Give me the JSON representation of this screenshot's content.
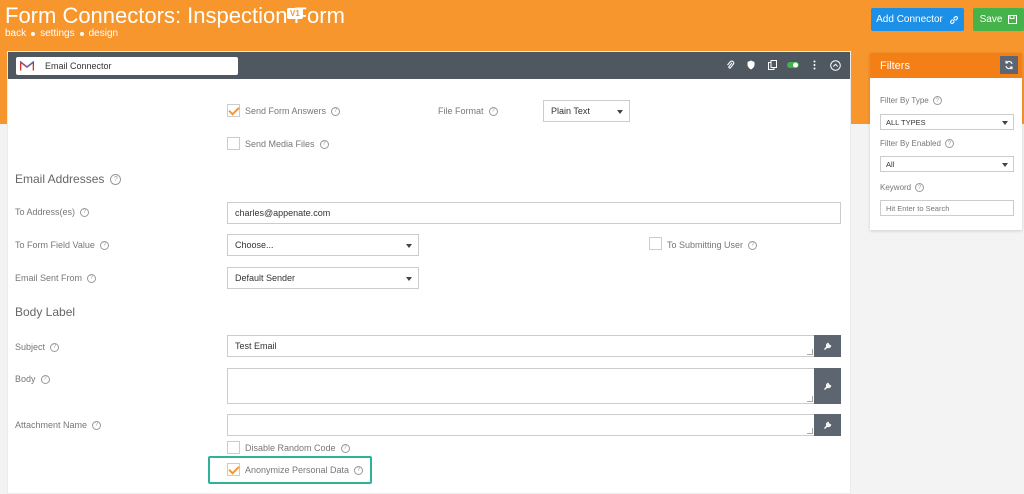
{
  "header": {
    "title": "Form Connectors: Inspection Form",
    "version": "V1",
    "breadcrumb": [
      "back",
      "settings",
      "design"
    ],
    "add_connector_label": "Add Connector",
    "save_label": "Save"
  },
  "connector": {
    "name": "Email Connector"
  },
  "options": {
    "send_form_answers": "Send Form Answers",
    "send_media_files": "Send Media Files",
    "file_format_label": "File Format",
    "file_format_value": "Plain Text"
  },
  "email_addresses": {
    "section_title": "Email Addresses",
    "to_address_label": "To Address(es)",
    "to_address_value": "charles@appenate.com",
    "to_form_field_label": "To Form Field Value",
    "to_form_field_value": "Choose...",
    "to_submitting_user": "To Submitting User",
    "sent_from_label": "Email Sent From",
    "sent_from_value": "Default Sender"
  },
  "body_label": {
    "section_title": "Body Label",
    "subject_label": "Subject",
    "subject_value": "Test Email",
    "body_label": "Body",
    "body_value": "",
    "attachment_label": "Attachment Name",
    "attachment_value": "",
    "disable_random_code": "Disable Random Code",
    "anonymize_personal_data": "Anonymize Personal Data"
  },
  "filters": {
    "title": "Filters",
    "type_label": "Filter By Type",
    "type_value": "ALL TYPES",
    "enabled_label": "Filter By Enabled",
    "enabled_value": "All",
    "keyword_label": "Keyword",
    "keyword_placeholder": "Hit Enter to Search"
  },
  "colors": {
    "header": "#f7962d",
    "filters_header": "#f57f17",
    "add_button": "#1c8fe6",
    "save_button": "#45b34a",
    "card_bar": "#4f5761",
    "highlight": "#2eb39a"
  },
  "icons": [
    "gmail-icon",
    "paperclip-icon",
    "shield-icon",
    "copy-icon",
    "toggle-icon",
    "more-vertical-icon",
    "collapse-icon",
    "link-icon",
    "save-icon",
    "wrench-icon",
    "refresh-icon",
    "help-icon"
  ]
}
